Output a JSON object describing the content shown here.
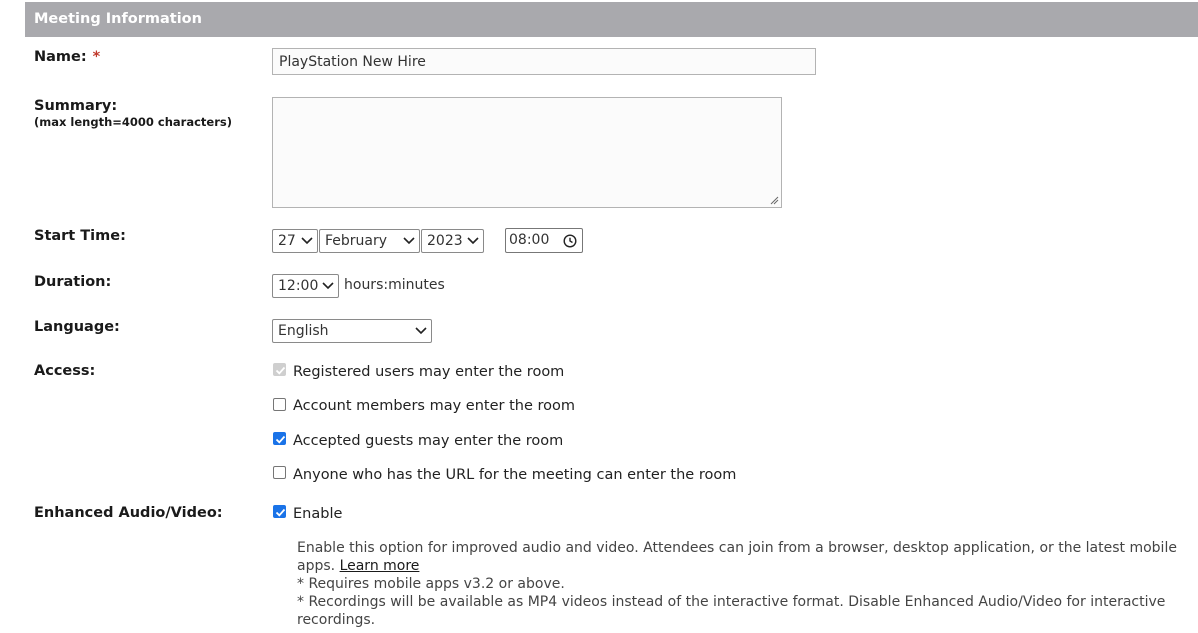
{
  "section": {
    "title": "Meeting Information"
  },
  "name": {
    "label": "Name:",
    "required_mark": "*",
    "value": "PlayStation New Hire"
  },
  "summary": {
    "label": "Summary:",
    "sublabel": "(max length=4000 characters)",
    "value": ""
  },
  "start_time": {
    "label": "Start Time:",
    "day": "27",
    "month": "February",
    "year": "2023",
    "hour": "08",
    "minute": "00"
  },
  "duration": {
    "label": "Duration:",
    "value": "12:00",
    "unit": "hours:minutes"
  },
  "language": {
    "label": "Language:",
    "value": "English"
  },
  "access": {
    "label": "Access:",
    "options": [
      {
        "label": "Registered users may enter the room",
        "checked": true,
        "disabled": true
      },
      {
        "label": "Account members may enter the room",
        "checked": false,
        "disabled": false
      },
      {
        "label": "Accepted guests may enter the room",
        "checked": true,
        "disabled": false
      },
      {
        "label": "Anyone who has the URL for the meeting can enter the room",
        "checked": false,
        "disabled": false
      }
    ]
  },
  "enhanced_av": {
    "label": "Enhanced Audio/Video:",
    "option_label": "Enable",
    "checked": true,
    "help_text": "Enable this option for improved audio and video. Attendees can join from a browser, desktop application, or the latest mobile apps.",
    "learn_more": "Learn more",
    "note1": "* Requires mobile apps v3.2 or above.",
    "note2": "* Recordings will be available as MP4 videos instead of the interactive format. Disable Enhanced Audio/Video for interactive recordings."
  },
  "colors": {
    "header_bg": "#a9a9ad",
    "checkbox_blue": "#1a73e8",
    "required_red": "#c0392b"
  },
  "icons": {
    "dropdown": "chevron-down-icon",
    "clock": "clock-icon",
    "check": "checkmark-icon",
    "resize": "resize-grip-icon"
  }
}
